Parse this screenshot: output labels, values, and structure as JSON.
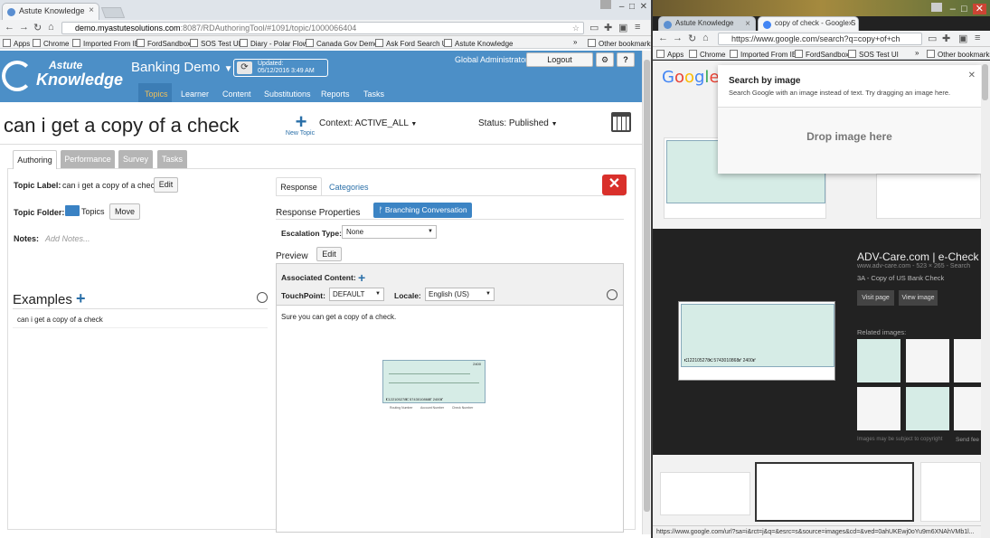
{
  "left_browser": {
    "tab_title": "Astute Knowledge",
    "url_host": "demo.myastutesolutions.com",
    "url_path": ":8087/RDAuthoringTool/#1091/topic/1000066404",
    "bookmarks": [
      "Apps",
      "Chrome",
      "Imported From IE",
      "FordSandbox",
      "SOS Test UI",
      "Diary - Polar Flow",
      "Canada Gov Demo",
      "Ask Ford Search UI",
      "Astute Knowledge"
    ],
    "other_bookmarks": "Other bookmarks"
  },
  "app": {
    "logo_top": "Astute",
    "logo_bottom": "Knowledge",
    "workspace": "Banking Demo",
    "updated_label": "Updated:",
    "updated_value": "05/12/2016 3:49 AM",
    "user_role": "Global Administrator",
    "logout_label": "Logout",
    "nav": [
      "Topics",
      "Learner",
      "Content",
      "Substitutions",
      "Reports",
      "Tasks"
    ],
    "topic_title": "can i get a copy of a check",
    "new_topic_label": "New Topic",
    "context_label": "Context: ACTIVE_ALL",
    "status_label": "Status: Published",
    "tabs": [
      "Authoring",
      "Performance",
      "Survey",
      "Tasks"
    ],
    "topic_label_caption": "Topic Label:",
    "topic_label_value": "can i get a copy of a check",
    "edit_label": "Edit",
    "topic_folder_caption": "Topic Folder:",
    "topic_folder_value": "Topics",
    "move_label": "Move",
    "notes_caption": "Notes:",
    "notes_placeholder": "Add Notes...",
    "examples_title": "Examples",
    "example_item": "can i get a copy of a check",
    "right_tabs": [
      "Response",
      "Categories"
    ],
    "response_properties": "Response Properties",
    "branching_label": "Branching Conversation",
    "escalation_caption": "Escalation Type:",
    "escalation_value": "None",
    "preview_label": "Preview",
    "preview_edit": "Edit",
    "associated_content": "Associated Content:",
    "touchpoint_caption": "TouchPoint:",
    "touchpoint_value": "DEFAULT",
    "locale_caption": "Locale:",
    "locale_value": "English (US)",
    "response_text": "Sure you can get a copy of a check."
  },
  "right_browser": {
    "tab1_title": "Astute Knowledge",
    "tab2_title": "copy of check - Google S",
    "url": "https://www.google.com/search?q=copy+of+ch",
    "bookmarks": [
      "Apps",
      "Chrome",
      "Imported From IE",
      "FordSandbox",
      "SOS Test UI"
    ],
    "other_bookmarks": "Other bookmarks",
    "search_by_image_title": "Search by image",
    "search_by_image_hint": "Search Google with an image instead of text. Try dragging an image here.",
    "drop_image": "Drop image here",
    "result_title": "ADV-Care.com | e-Check",
    "result_meta": "www.adv-care.com - 523 × 265 - Search",
    "result_desc": "3A - Copy of US Bank Check",
    "visit_page": "Visit page",
    "view_image": "View image",
    "related_images": "Images may be subject to copyright",
    "related_label": "Related images:",
    "send_feedback": "Send fee",
    "status_url": "https://www.google.com/url?sa=i&rct=j&q=&esrc=s&source=images&cd=&ved=0ahUKEwj0oYu9m6XNAhVMb1l..."
  },
  "check": {
    "number": "2400",
    "routing_label": "Routing Number",
    "account_label": "Account Number",
    "check_label": "Check Number",
    "micr": "⑆122105278⑆  5743010868⑈  2400⑈",
    "dollars": "DOLLARS",
    "pay_to": "PAY TO THE ORDER OF"
  },
  "colors": {
    "app_blue": "#4c8fc7",
    "nav_active": "#f0c05a",
    "close_red": "#d9302b",
    "check_green": "#d6ece6"
  }
}
